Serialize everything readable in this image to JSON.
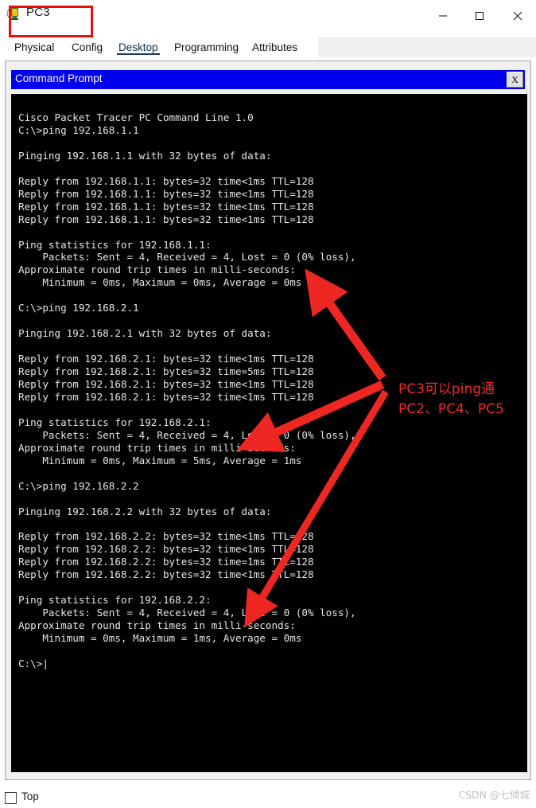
{
  "window": {
    "title": "PC3",
    "icon": "packet-tracer-pc-icon",
    "minimize_label": "─",
    "maximize_label": "□",
    "close_label": "✕",
    "highlight_color": "#e8100f"
  },
  "tabs": [
    {
      "label": "Physical",
      "active": false
    },
    {
      "label": "Config",
      "active": false
    },
    {
      "label": "Desktop",
      "active": true
    },
    {
      "label": "Programming",
      "active": false
    },
    {
      "label": "Attributes",
      "active": false
    }
  ],
  "command_prompt": {
    "title": "Command Prompt",
    "close_label": "X",
    "titlebar_color": "#0000ee",
    "terminal_bg": "#000000",
    "terminal_fg": "#e6e6e6",
    "content": "Cisco Packet Tracer PC Command Line 1.0\nC:\\>ping 192.168.1.1\n\nPinging 192.168.1.1 with 32 bytes of data:\n\nReply from 192.168.1.1: bytes=32 time<1ms TTL=128\nReply from 192.168.1.1: bytes=32 time<1ms TTL=128\nReply from 192.168.1.1: bytes=32 time<1ms TTL=128\nReply from 192.168.1.1: bytes=32 time<1ms TTL=128\n\nPing statistics for 192.168.1.1:\n    Packets: Sent = 4, Received = 4, Lost = 0 (0% loss),\nApproximate round trip times in milli-seconds:\n    Minimum = 0ms, Maximum = 0ms, Average = 0ms\n\nC:\\>ping 192.168.2.1\n\nPinging 192.168.2.1 with 32 bytes of data:\n\nReply from 192.168.2.1: bytes=32 time<1ms TTL=128\nReply from 192.168.2.1: bytes=32 time=5ms TTL=128\nReply from 192.168.2.1: bytes=32 time<1ms TTL=128\nReply from 192.168.2.1: bytes=32 time<1ms TTL=128\n\nPing statistics for 192.168.2.1:\n    Packets: Sent = 4, Received = 4, Lost = 0 (0% loss),\nApproximate round trip times in milli-seconds:\n    Minimum = 0ms, Maximum = 5ms, Average = 1ms\n\nC:\\>ping 192.168.2.2\n\nPinging 192.168.2.2 with 32 bytes of data:\n\nReply from 192.168.2.2: bytes=32 time<1ms TTL=128\nReply from 192.168.2.2: bytes=32 time<1ms TTL=128\nReply from 192.168.2.2: bytes=32 time=1ms TTL=128\nReply from 192.168.2.2: bytes=32 time<1ms TTL=128\n\nPing statistics for 192.168.2.2:\n    Packets: Sent = 4, Received = 4, Lost = 0 (0% loss),\nApproximate round trip times in milli-seconds:\n    Minimum = 0ms, Maximum = 1ms, Average = 0ms\n\nC:\\>|"
  },
  "annotation": {
    "text": "PC3可以ping通\nPC2、PC4、PC5",
    "color": "#ef2b24",
    "arrow_color": "#ee2722",
    "arrow_count": 3
  },
  "bottom_bar": {
    "top_label": "Top",
    "top_checked": false,
    "watermark": "CSDN @七倾城"
  }
}
